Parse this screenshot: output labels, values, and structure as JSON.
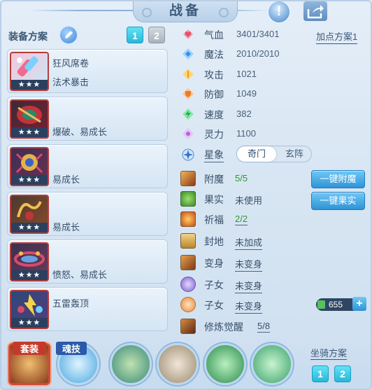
{
  "title": "战备",
  "colors": {
    "accent": "#27b7da",
    "rarity_border": "#b33d3d",
    "green_value": "#2d9a2d"
  },
  "icons": {
    "help": "exclamation-icon",
    "share": "share-icon",
    "edit": "pencil-icon"
  },
  "equip_plan": {
    "label": "装备方案",
    "buttons": [
      "1",
      "2"
    ],
    "selected": "1"
  },
  "equipment": [
    {
      "line1": "狂风席卷",
      "line2": "法术暴击",
      "stars": "★★★"
    },
    {
      "line1": "",
      "line2": "爆破、易成长",
      "stars": "★★★"
    },
    {
      "line1": "",
      "line2": "易成长",
      "stars": "★★★"
    },
    {
      "line1": "",
      "line2": "易成长",
      "stars": "★★★"
    },
    {
      "line1": "",
      "line2": "愤怒、易成长",
      "stars": "★★★"
    },
    {
      "line1": "五雷轰顶",
      "line2": "",
      "stars": "★★★"
    }
  ],
  "add_plan": "加点方案1",
  "stats": [
    {
      "label": "气血",
      "value": "3401/3401",
      "color": "#e0546a"
    },
    {
      "label": "魔法",
      "value": "2010/2010",
      "color": "#4aa3f0"
    },
    {
      "label": "攻击",
      "value": "1021",
      "color": "#f2b640"
    },
    {
      "label": "防御",
      "value": "1049",
      "color": "#f09a4a"
    },
    {
      "label": "速度",
      "value": "382",
      "color": "#3dcf6e"
    },
    {
      "label": "灵力",
      "value": "1100",
      "color": "#c98de8"
    }
  ],
  "xingxiang": {
    "label": "星象",
    "tabs": [
      "奇门",
      "玄阵"
    ],
    "selected": "奇门"
  },
  "features": [
    {
      "label": "附魔",
      "value": "5/5"
    },
    {
      "label": "果实",
      "value": "未使用"
    },
    {
      "label": "祈福",
      "value": "2/2"
    },
    {
      "label": "封地",
      "value": "未加成"
    },
    {
      "label": "变身",
      "value": "未变身"
    },
    {
      "label": "子女",
      "value": "未变身"
    },
    {
      "label": "子女",
      "value": "未变身"
    },
    {
      "label": "修炼觉醒",
      "value": "5/8"
    }
  ],
  "actions": {
    "enchant": "一键附魔",
    "fruit": "一键果实"
  },
  "currency": {
    "amount": "655",
    "plus": "+"
  },
  "bottom": {
    "suit_label": "套装",
    "soul_label": "魂技",
    "mount_label": "坐骑方案",
    "mount_buttons": [
      "1",
      "2"
    ]
  }
}
